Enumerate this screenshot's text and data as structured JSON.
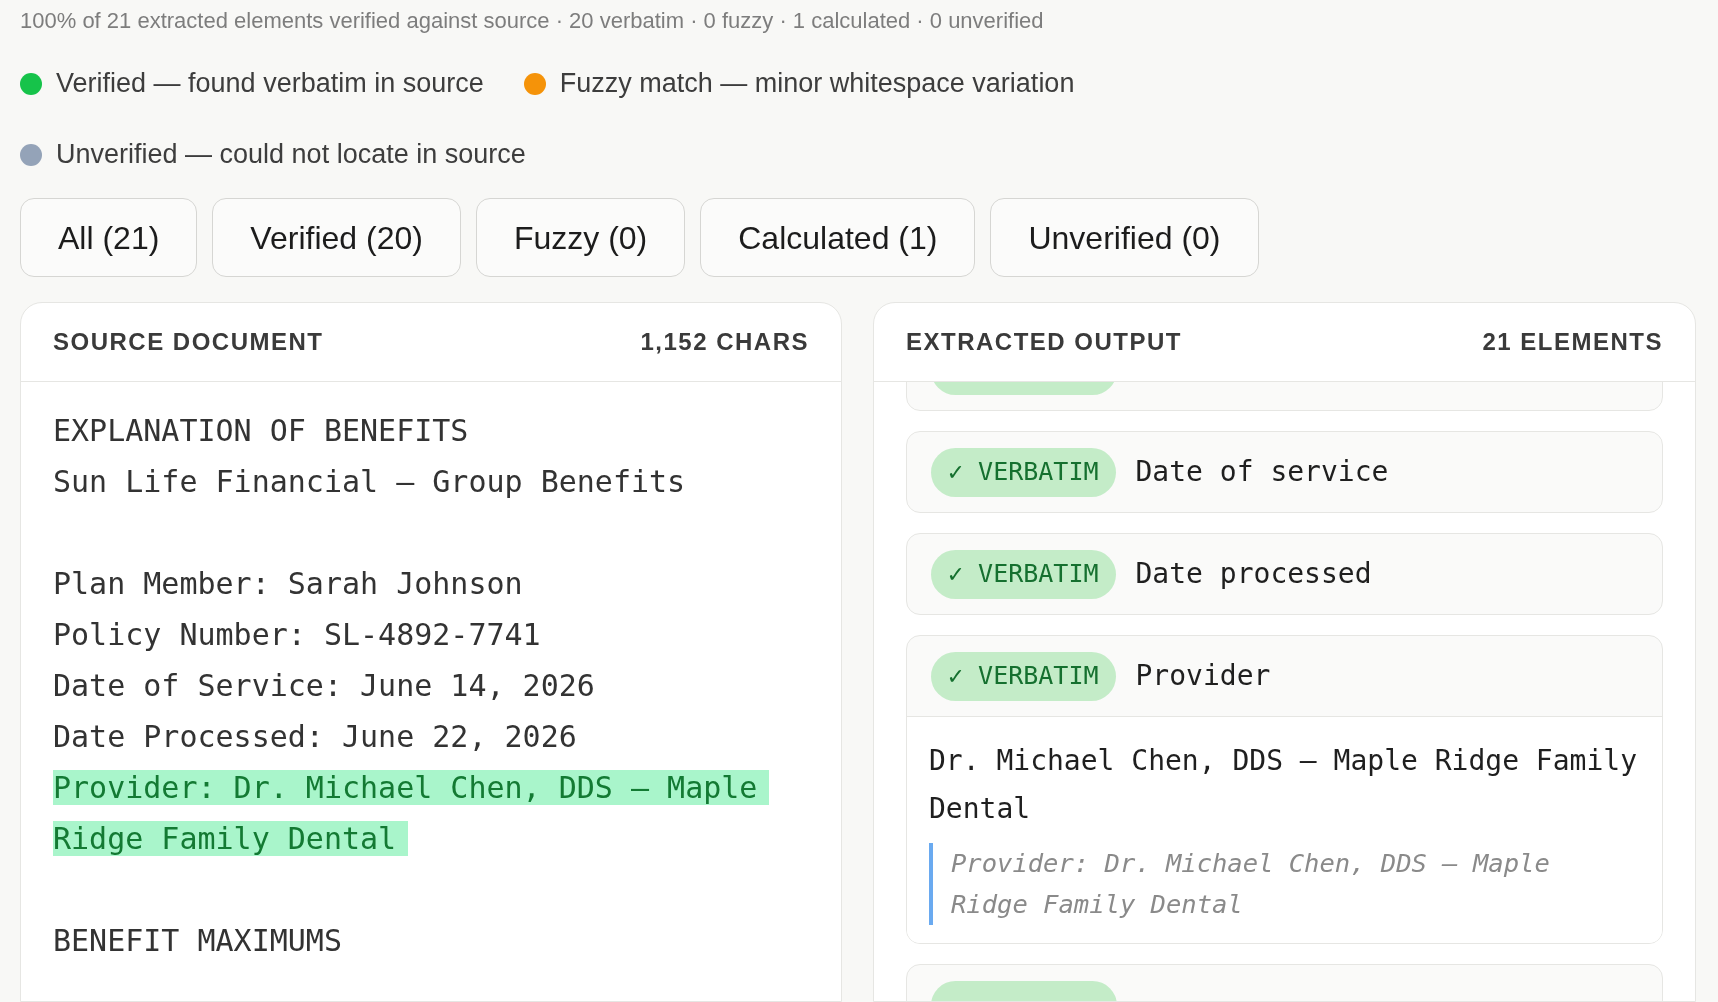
{
  "summary": "100% of 21 extracted elements verified against source · 20 verbatim · 0 fuzzy · 1 calculated · 0 unverified",
  "legend": [
    {
      "label": "Verified — found verbatim in source",
      "color": "#16c34a"
    },
    {
      "label": "Fuzzy match — minor whitespace variation",
      "color": "#f59309"
    },
    {
      "label": "Unverified — could not locate in source",
      "color": "#94a3b8"
    }
  ],
  "filters": [
    {
      "label": "All (21)",
      "selected": false
    },
    {
      "label": "Verified (20)",
      "selected": false
    },
    {
      "label": "Fuzzy (0)",
      "selected": false
    },
    {
      "label": "Calculated (1)",
      "selected": false
    },
    {
      "label": "Unverified (0)",
      "selected": false
    }
  ],
  "source": {
    "title": "SOURCE DOCUMENT",
    "count": "1,152 CHARS",
    "blocks": [
      [
        {
          "text": "EXPLANATION OF BENEFITS",
          "highlighted": false
        },
        {
          "text": "Sun Life Financial — Group Benefits",
          "highlighted": false
        }
      ],
      [
        {
          "text": "Plan Member: Sarah Johnson",
          "highlighted": false
        },
        {
          "text": "Policy Number: SL-4892-7741",
          "highlighted": false
        },
        {
          "text": "Date of Service: June 14, 2026",
          "highlighted": false
        },
        {
          "text": "Date Processed: June 22, 2026",
          "highlighted": false
        },
        {
          "text": "Provider: Dr. Michael Chen, DDS — Maple Ridge Family Dental",
          "highlighted": true
        }
      ],
      [
        {
          "text": "BENEFIT MAXIMUMS",
          "highlighted": false
        }
      ]
    ]
  },
  "output": {
    "title": "EXTRACTED OUTPUT",
    "count": "21 ELEMENTS",
    "elements": [
      {
        "kind": "cut"
      },
      {
        "kind": "row",
        "badge": "✓ VERBATIM",
        "label": "Date of service",
        "expanded": false
      },
      {
        "kind": "row",
        "badge": "✓ VERBATIM",
        "label": "Date processed",
        "expanded": false
      },
      {
        "kind": "row",
        "badge": "✓ VERBATIM",
        "label": "Provider",
        "expanded": true,
        "value": "Dr. Michael Chen, DDS — Maple Ridge Family Dental",
        "quote": "Provider: Dr. Michael Chen, DDS — Maple Ridge Family Dental"
      },
      {
        "kind": "cut"
      }
    ]
  }
}
